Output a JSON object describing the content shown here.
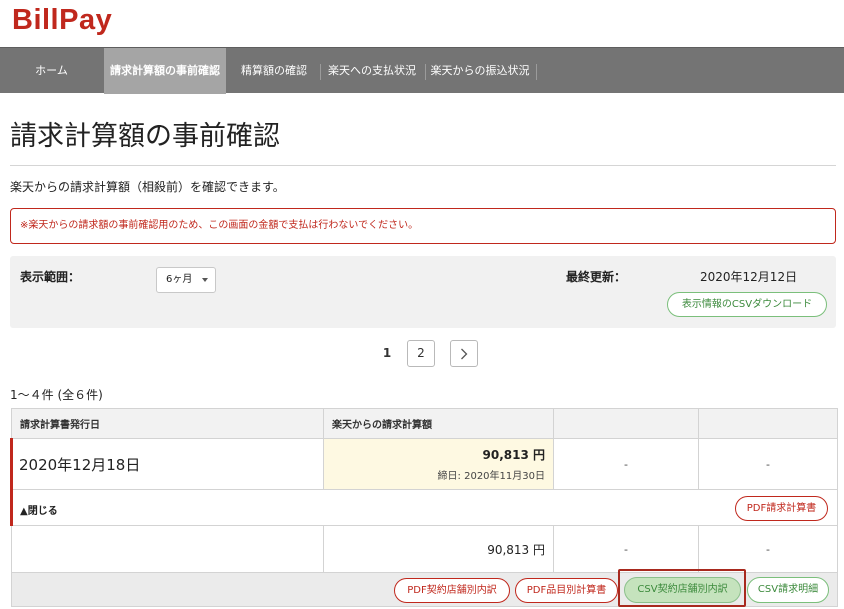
{
  "app": {
    "logo": "BillPay"
  },
  "nav": {
    "items": [
      {
        "label": "ホーム"
      },
      {
        "label": "請求計算額の事前確認"
      },
      {
        "label": "精算額の確認"
      },
      {
        "label": "楽天への支払状況"
      },
      {
        "label": "楽天からの振込状況"
      }
    ]
  },
  "page": {
    "title": "請求計算額の事前確認",
    "description": "楽天からの請求計算額（相殺前）を確認できます。",
    "alert": "※楽天からの請求額の事前確認用のため、この画面の金額で支払は行わないでください。"
  },
  "filter": {
    "range_label": "表示範囲：",
    "range_value": "6ヶ月",
    "updated_label": "最終更新：",
    "updated_value": "2020年12月12日",
    "csv_download": "表示情報のCSVダウンロード"
  },
  "pagination": {
    "current": "1",
    "next_page": "2"
  },
  "result_count": "1～４件 (全６件)",
  "table": {
    "headers": [
      "請求計算書発行日",
      "楽天からの請求計算額",
      "",
      ""
    ],
    "row1": {
      "date": "2020年12月18日",
      "amount": "90,813 円",
      "deadline": "締日: 2020年11月30日",
      "col3": "-",
      "col4": "-"
    },
    "row2": {
      "close": "▲閉じる",
      "pdf_invoice": "PDF請求計算書"
    },
    "row3": {
      "amount": "90,813 円",
      "col3": "-",
      "col4": "-"
    },
    "row4": {
      "pdf_store": "PDF契約店舗別内訳",
      "pdf_item": "PDF品目別計算書",
      "csv_store": "CSV契約店舗別内訳",
      "csv_detail": "CSV請求明細"
    }
  },
  "colors": {
    "brand": "#c0281d",
    "nav_bg": "#747474",
    "nav_active": "#a5a5a5",
    "accent_green": "#3c8a3c",
    "amount_bg": "#fef9e2"
  }
}
